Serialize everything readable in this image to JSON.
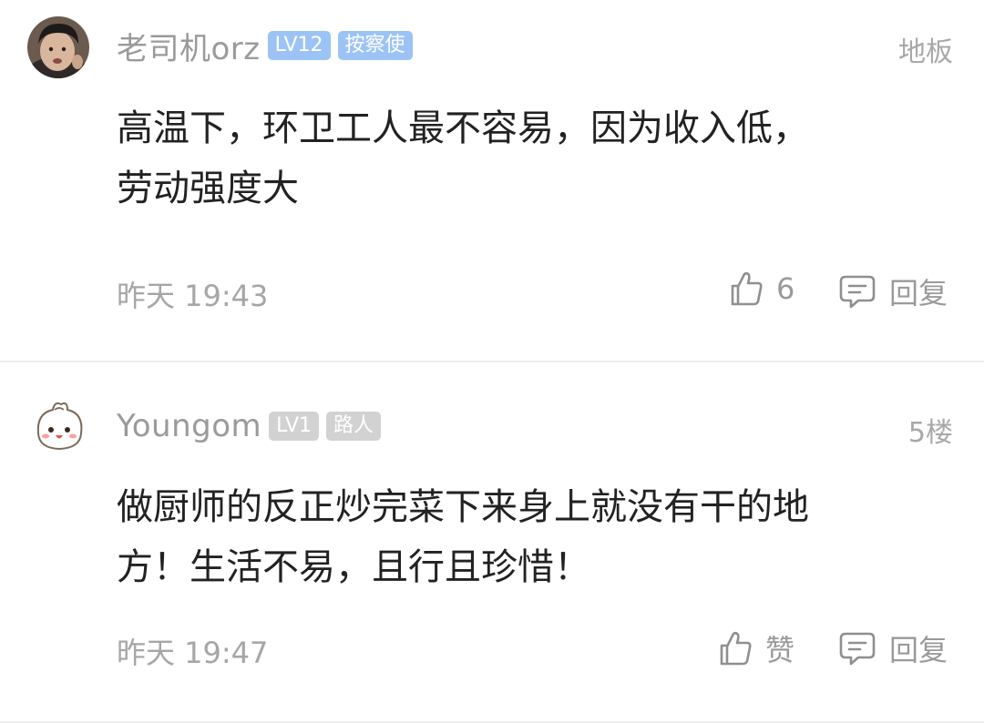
{
  "comments": [
    {
      "username": "老司机orz",
      "level_badge": "LV12",
      "title_badge": "按察使",
      "floor": "地板",
      "text_line1": "高温下，环卫工人最不容易，因为收入低，",
      "text_line2": "劳动强度大",
      "time": "昨天 19:43",
      "like_label": "6",
      "reply_label": "回复"
    },
    {
      "username": "Youngom",
      "level_badge": "LV1",
      "title_badge": "路人",
      "floor": "5楼",
      "text_line1": "做厨师的反正炒完菜下来身上就没有干的地",
      "text_line2": "方！生活不易，且行且珍惜！",
      "time": "昨天 19:47",
      "like_label": "赞",
      "reply_label": "回复"
    }
  ],
  "icons": {
    "like": "thumbs-up-icon",
    "reply": "comment-bubble-icon"
  },
  "colors": {
    "level_badge_blue": "#9cc3f6",
    "badge_gray": "#d2d2d2",
    "meta_gray": "#9a9a9a",
    "text": "#222222"
  }
}
